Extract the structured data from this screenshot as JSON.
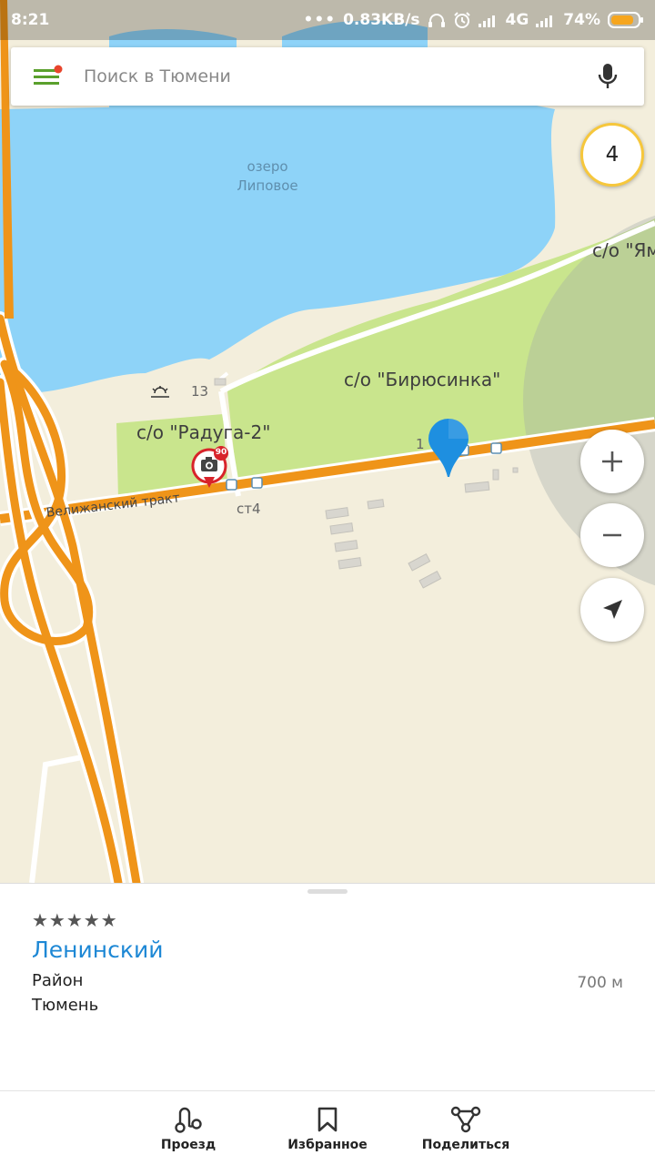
{
  "status_bar": {
    "time": "8:21",
    "network_speed": "0.83KB/s",
    "network_type": "4G",
    "battery": "74%"
  },
  "search": {
    "placeholder": "Поиск в Тюмени"
  },
  "map": {
    "lake_label_1": "озеро",
    "lake_label_2": "Липовое",
    "area_biryusinka": "с/о \"Бирюсинка\"",
    "area_raduga": "с/о \"Радуга-2\"",
    "area_yam": "с/о \"Ям",
    "road_name": "Велижанский тракт",
    "house_13": "13",
    "house_s14": "ст4",
    "house_1": "1",
    "speed_camera_limit": "90",
    "colors": {
      "water": "#8ed3f8",
      "park": "#c9e58d",
      "land": "#f3eedc",
      "major_road": "#ef9419",
      "pin": "#1e8fe0"
    }
  },
  "traffic_level": "4",
  "controls": {
    "zoom_in_icon": "plus-icon",
    "zoom_out_icon": "minus-icon",
    "locate_icon": "navigation-arrow-icon"
  },
  "place": {
    "rating_stars": "★★★★★",
    "title": "Ленинский",
    "type": "Район",
    "city": "Тюмень",
    "distance": "700 м"
  },
  "actions": {
    "route_label": "Проезд",
    "favorites_label": "Избранное",
    "share_label": "Поделиться"
  }
}
